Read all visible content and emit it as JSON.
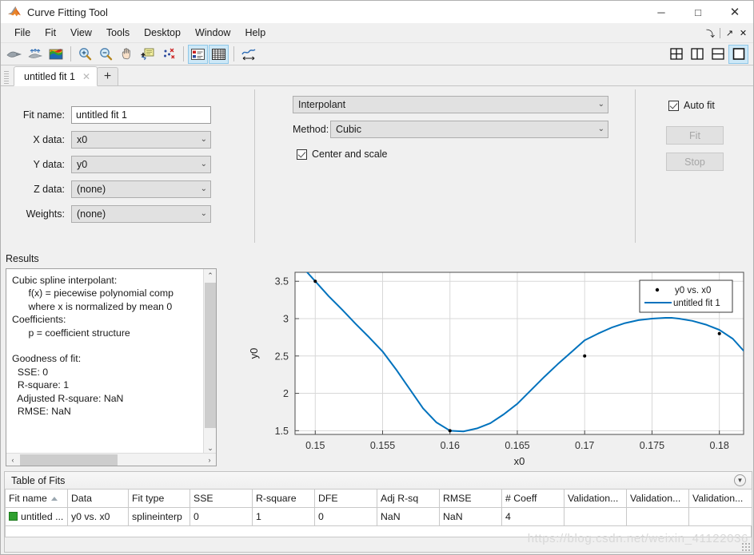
{
  "window": {
    "title": "Curve Fitting Tool",
    "icon": "matlab-icon",
    "minimize": "─",
    "maximize": "□",
    "close": "✕",
    "dock": "⤵",
    "undock": "↗",
    "panel_close": "✕"
  },
  "menubar": {
    "items": [
      {
        "label": "File"
      },
      {
        "label": "Fit"
      },
      {
        "label": "View"
      },
      {
        "label": "Tools"
      },
      {
        "label": "Desktop"
      },
      {
        "label": "Window"
      },
      {
        "label": "Help"
      }
    ]
  },
  "toolbar": {
    "left_buttons": [
      {
        "name": "fit-curve-icon",
        "tooltip": "Fit"
      },
      {
        "name": "exclude-outliers-icon",
        "tooltip": "Exclude outliers"
      },
      {
        "name": "surface-plot-icon",
        "tooltip": "Surface plot"
      }
    ],
    "zoom_buttons": [
      {
        "name": "zoom-in-icon",
        "tooltip": "Zoom In"
      },
      {
        "name": "zoom-out-icon",
        "tooltip": "Zoom Out"
      },
      {
        "name": "pan-icon",
        "tooltip": "Pan"
      },
      {
        "name": "data-cursor-icon",
        "tooltip": "Data Cursor"
      },
      {
        "name": "exclude-points-icon",
        "tooltip": "Exclude Points"
      }
    ],
    "view_buttons": [
      {
        "name": "legend-icon",
        "tooltip": "Legend",
        "selected": true
      },
      {
        "name": "grid-icon",
        "tooltip": "Grid",
        "selected": true
      }
    ],
    "axes_buttons": [
      {
        "name": "axes-limits-icon",
        "tooltip": "Axes Limits"
      }
    ],
    "layout_buttons": [
      {
        "name": "layout-grid-icon",
        "tooltip": "Tile 2x2",
        "selected": false
      },
      {
        "name": "layout-vertical-icon",
        "tooltip": "Tile vertical",
        "selected": false
      },
      {
        "name": "layout-horizontal-icon",
        "tooltip": "Tile horizontal",
        "selected": false
      },
      {
        "name": "layout-single-icon",
        "tooltip": "Single",
        "selected": true
      }
    ]
  },
  "tabs": {
    "items": [
      {
        "label": "untitled fit 1",
        "close": "✕",
        "active": true
      }
    ],
    "add_label": "+"
  },
  "fit_editor": {
    "fit_name_label": "Fit name:",
    "fit_name_value": "untitled fit 1",
    "x_data_label": "X data:",
    "x_data_value": "x0",
    "y_data_label": "Y data:",
    "y_data_value": "y0",
    "z_data_label": "Z data:",
    "z_data_value": "(none)",
    "weights_label": "Weights:",
    "weights_value": "(none)",
    "fit_type_value": "Interpolant",
    "method_label": "Method:",
    "method_value": "Cubic",
    "center_and_scale_label": "Center and scale",
    "center_and_scale_checked": true,
    "auto_fit_label": "Auto fit",
    "auto_fit_checked": true,
    "fit_button_label": "Fit",
    "stop_button_label": "Stop",
    "chevron": "⌄"
  },
  "results": {
    "title": "Results",
    "text": "Cubic spline interpolant:\n      f(x) = piecewise polynomial comp\n      where x is normalized by mean 0\nCoefficients:\n      p = coefficient structure\n\nGoodness of fit:\n  SSE: 0\n  R-square: 1\n  Adjusted R-square: NaN\n  RMSE: NaN",
    "scroll_up": "⌃",
    "scroll_down": "⌄",
    "scroll_left": "‹",
    "scroll_right": "›"
  },
  "chart_data": {
    "type": "line",
    "title": "",
    "xlabel": "x0",
    "ylabel": "y0",
    "xlim": [
      0.1485,
      0.1818
    ],
    "ylim": [
      1.45,
      3.62
    ],
    "xticks": [
      0.15,
      0.155,
      0.16,
      0.165,
      0.17,
      0.175,
      0.18
    ],
    "xticklabels": [
      "0.15",
      "0.155",
      "0.16",
      "0.165",
      "0.17",
      "0.175",
      "0.18"
    ],
    "yticks": [
      1.5,
      2,
      2.5,
      3,
      3.5
    ],
    "yticklabels": [
      "1.5",
      "2",
      "2.5",
      "3",
      "3.5"
    ],
    "grid": true,
    "legend_position": "upper right",
    "series": [
      {
        "name": "y0 vs. x0",
        "type": "scatter",
        "marker": "point",
        "color": "#000000",
        "x": [
          0.15,
          0.16,
          0.17,
          0.18
        ],
        "y": [
          3.5,
          1.5,
          2.5,
          2.8
        ]
      },
      {
        "name": "untitled fit 1",
        "type": "line",
        "color": "#0072BD",
        "linewidth": 2,
        "x": [
          0.1485,
          0.149,
          0.15,
          0.151,
          0.152,
          0.153,
          0.154,
          0.155,
          0.156,
          0.157,
          0.158,
          0.159,
          0.16,
          0.161,
          0.162,
          0.163,
          0.164,
          0.165,
          0.166,
          0.167,
          0.168,
          0.169,
          0.17,
          0.171,
          0.172,
          0.173,
          0.174,
          0.175,
          0.176,
          0.1765,
          0.177,
          0.178,
          0.179,
          0.18,
          0.181,
          0.1818
        ],
        "y": [
          3.79,
          3.7,
          3.5,
          3.3,
          3.12,
          2.93,
          2.75,
          2.56,
          2.32,
          2.06,
          1.8,
          1.61,
          1.5,
          1.49,
          1.53,
          1.6,
          1.72,
          1.86,
          2.04,
          2.22,
          2.39,
          2.55,
          2.71,
          2.8,
          2.88,
          2.94,
          2.98,
          3.0,
          3.01,
          3.01,
          3.0,
          2.97,
          2.92,
          2.85,
          2.73,
          2.57
        ]
      }
    ]
  },
  "table_of_fits": {
    "title": "Table of Fits",
    "collapse_icon": "▼",
    "columns": [
      "Fit name",
      "Data",
      "Fit type",
      "SSE",
      "R-square",
      "DFE",
      "Adj R-sq",
      "RMSE",
      "# Coeff",
      "Validation...",
      "Validation...",
      "Validation..."
    ],
    "sorted_column": "Fit name",
    "rows": [
      {
        "swatch_color": "#2fa02f",
        "cells": [
          "untitled ...",
          "y0 vs. x0",
          "splineinterp",
          "0",
          "1",
          "0",
          "NaN",
          "NaN",
          "4",
          "",
          "",
          ""
        ]
      }
    ]
  },
  "watermark": "https://blog.csdn.net/weixin_41122036",
  "colors": {
    "accent_blue": "#0072BD",
    "selected_toolbar": "#cde8f7",
    "window_bg": "#f0f0f0"
  }
}
